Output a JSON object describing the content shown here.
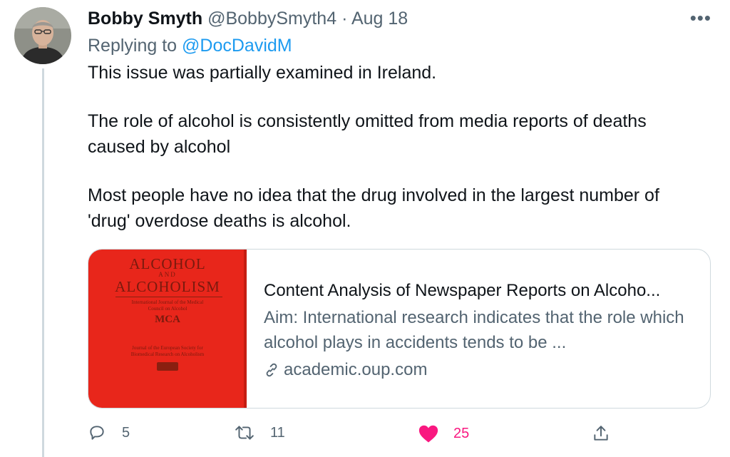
{
  "tweet": {
    "author_name": "Bobby Smyth",
    "handle": "@BobbySmyth4",
    "separator": "·",
    "date": "Aug 18",
    "more_icon": "more-horizontal-icon",
    "replying_prefix": "Replying to",
    "replying_to": "@DocDavidM",
    "paragraphs": [
      "This issue was partially examined in Ireland.",
      "The role of alcohol is consistently omitted from media reports of deaths caused by alcohol",
      "Most people have no idea that the drug involved in the largest number of 'drug' overdose deaths is alcohol."
    ]
  },
  "card": {
    "cover": {
      "title_line1": "ALCOHOL",
      "title_and": "AND",
      "title_line2": "ALCOHOLISM",
      "subtitle": "International Journal of the Medical Council on Alcohol",
      "logo": "MCA",
      "footer": "Journal of the European Society for Biomedical Research on Alcoholism",
      "color": "#e8261b"
    },
    "title": "Content Analysis of Newspaper Reports on Alcoho...",
    "description": "Aim: International research indicates that the role which alcohol plays in accidents tends to be ...",
    "domain": "academic.oup.com",
    "link_icon": "link-icon"
  },
  "actions": {
    "replies": "5",
    "retweets": "11",
    "likes": "25",
    "like_color": "#f91880",
    "icons": [
      "reply-icon",
      "retweet-icon",
      "heart-icon",
      "share-icon"
    ]
  }
}
